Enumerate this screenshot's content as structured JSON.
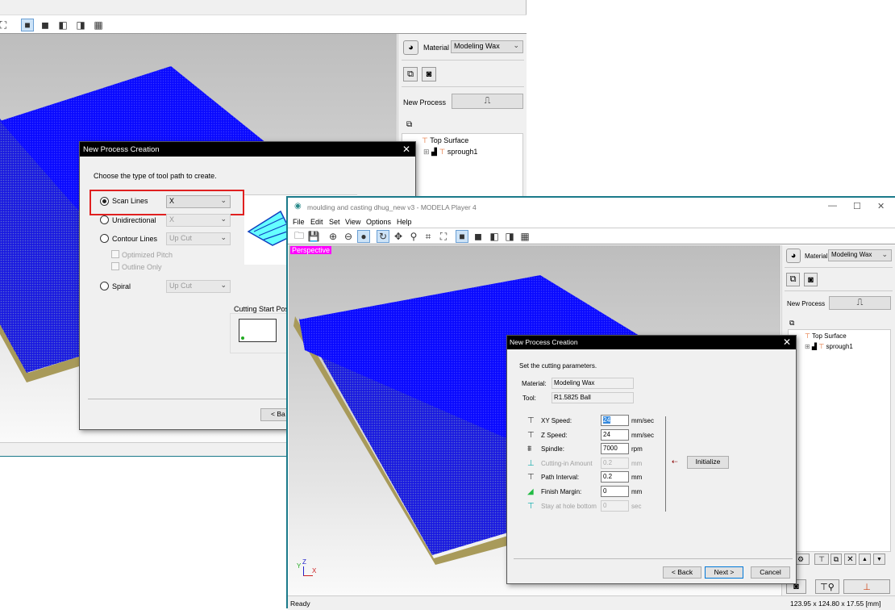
{
  "back_window": {
    "toolbar_icons": [
      "fit-view-icon",
      "solid-view-icon",
      "front-view-icon",
      "side-view-icon",
      "iso-view-icon",
      "four-view-icon"
    ],
    "panel": {
      "material_label": "Material",
      "material_value": "Modeling Wax",
      "new_process_label": "New Process",
      "tree": [
        {
          "label": "Top Surface"
        },
        {
          "label": "sprough1"
        }
      ]
    },
    "dialog": {
      "title": "New Process Creation",
      "instruction": "Choose the type of tool path to create.",
      "options": [
        {
          "label": "Scan Lines",
          "selected": true,
          "value": "X",
          "enabled": true
        },
        {
          "label": "Unidirectional",
          "selected": false,
          "value": "X",
          "enabled": false
        },
        {
          "label": "Contour Lines",
          "selected": false,
          "value": "Up Cut",
          "enabled": false
        },
        {
          "label": "Spiral",
          "selected": false,
          "value": "Up Cut",
          "enabled": false
        }
      ],
      "optimized_pitch": "Optimized Pitch",
      "outline_only": "Outline Only",
      "cutting_start_label": "Cutting Start Posit",
      "back_label": "< Ba",
      "highlight_color": "#e02020"
    }
  },
  "front_window": {
    "title": "moulding and casting  dhug_new v3 - MODELA Player 4",
    "menu": [
      "File",
      "Edit",
      "Set",
      "View",
      "Options",
      "Help"
    ],
    "view_label": "Perspective",
    "view_label_color": "#ff00ff",
    "axis_labels": {
      "y": "Y",
      "z": "Z",
      "x": "X"
    },
    "panel": {
      "material_label": "Material",
      "material_value": "Modeling Wax",
      "new_process_label": "New Process",
      "tree": [
        {
          "label": "Top Surface"
        },
        {
          "label": "sprough1"
        }
      ]
    },
    "status": "Ready",
    "dimensions": "123.95 x 124.80 x 17.55 [mm]",
    "dialog": {
      "title": "New Process Creation",
      "instruction": "Set the cutting parameters.",
      "material_label": "Material:",
      "material_value": "Modeling Wax",
      "tool_label": "Tool:",
      "tool_value": "R1.5825 Ball",
      "params": [
        {
          "icon": "xy-speed-icon",
          "label": "XY Speed:",
          "value": "24",
          "unit": "mm/sec",
          "enabled": true
        },
        {
          "icon": "z-speed-icon",
          "label": "Z Speed:",
          "value": "24",
          "unit": "mm/sec",
          "enabled": true
        },
        {
          "icon": "spindle-icon",
          "label": "Spindle:",
          "value": "7000",
          "unit": "rpm",
          "enabled": true
        },
        {
          "icon": "cutting-in-icon",
          "label": "Cutting-in Amount",
          "value": "0.2",
          "unit": "mm",
          "enabled": false
        },
        {
          "icon": "path-interval-icon",
          "label": "Path Interval:",
          "value": "0.2",
          "unit": "mm",
          "enabled": true
        },
        {
          "icon": "finish-margin-icon",
          "label": "Finish Margin:",
          "value": "0",
          "unit": "mm",
          "enabled": true
        },
        {
          "icon": "stay-hole-icon",
          "label": "Stay at hole bottom",
          "value": "0",
          "unit": "sec",
          "enabled": false
        }
      ],
      "initialize": "Initialize",
      "back": "< Back",
      "next": "Next >",
      "cancel": "Cancel"
    }
  },
  "colors": {
    "toolpath": "#0a0aff",
    "stock": "#a89a5a",
    "title_bar": "#000000",
    "window_border": "#1b7a8a"
  }
}
